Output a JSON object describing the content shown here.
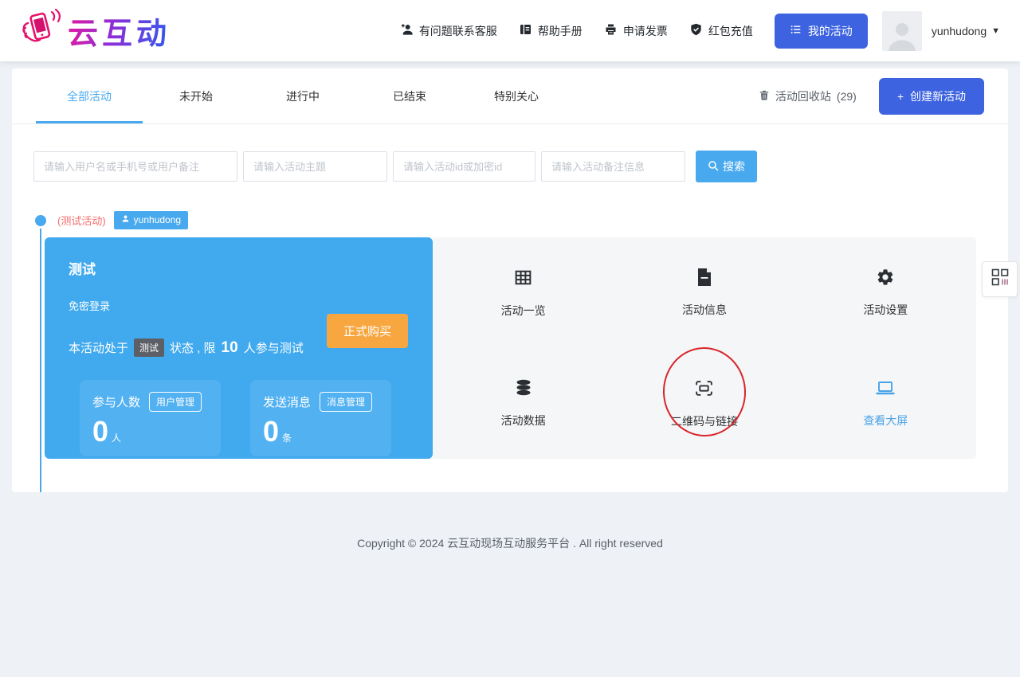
{
  "header": {
    "logo_text": "云互动",
    "nav": [
      {
        "label": "有问题联系客服",
        "icon": "contact-support-icon"
      },
      {
        "label": "帮助手册",
        "icon": "manual-book-icon"
      },
      {
        "label": "申请发票",
        "icon": "invoice-printer-icon"
      },
      {
        "label": "红包充值",
        "icon": "recharge-shield-icon"
      }
    ],
    "my_activities_label": "我的活动",
    "username": "yunhudong"
  },
  "tabs": {
    "items": [
      "全部活动",
      "未开始",
      "进行中",
      "已结束",
      "特别关心"
    ],
    "active": "全部活动",
    "recycle_label": "活动回收站",
    "recycle_count": "(29)",
    "create_plus": "+",
    "create_label": "创建新活动"
  },
  "search": {
    "placeholders": [
      "请输入用户名或手机号或用户备注",
      "请输入活动主题",
      "请输入活动id或加密id",
      "请输入活动备注信息"
    ],
    "button_label": "搜索"
  },
  "activity": {
    "tag": "(测试活动)",
    "owner": "yunhudong",
    "title": "测试",
    "login_mode": "免密登录",
    "status_prefix": "本活动处于",
    "status_badge": "测试",
    "status_middle": "状态 , 限",
    "status_count": "10",
    "status_suffix": "人参与测试",
    "buy_label": "正式购买",
    "stats": [
      {
        "label": "参与人数",
        "manage_label": "用户管理",
        "value": "0",
        "unit": "人"
      },
      {
        "label": "发送消息",
        "manage_label": "消息管理",
        "value": "0",
        "unit": "条"
      }
    ],
    "menu": [
      "活动一览",
      "活动信息",
      "活动设置",
      "活动数据",
      "二维码与链接",
      "查看大屏"
    ]
  },
  "footer": {
    "copyright": "Copyright © 2024 云互动现场互动服务平台 . All right reserved"
  },
  "colors": {
    "brand_royal_blue": "#3d63e0",
    "accent_light_blue": "#49a9ee",
    "card_blue": "#41aaee",
    "stat_box_blue": "#52b1f1",
    "buy_orange": "#f7a640",
    "tag_red": "#f56c6c",
    "annotation_red": "#d9252a",
    "panel_gray": "#f4f6f8"
  }
}
